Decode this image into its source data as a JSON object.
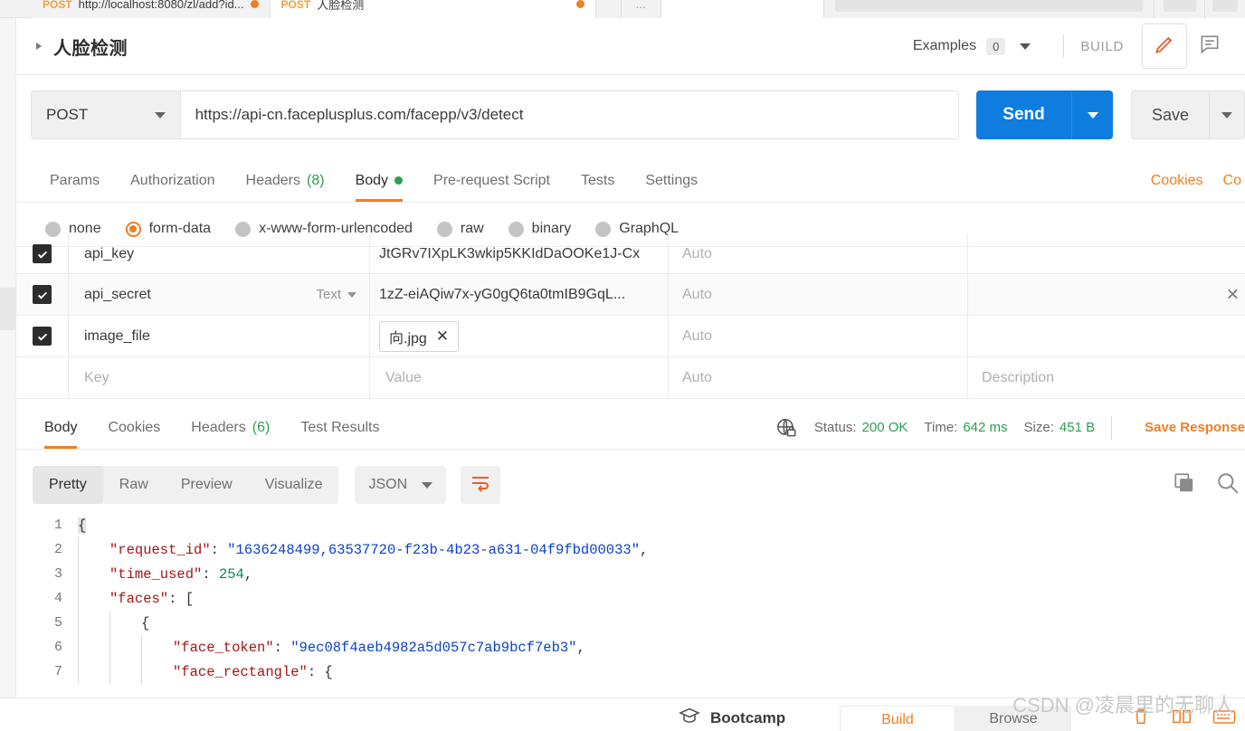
{
  "tabs": {
    "items": [
      {
        "method": "POST",
        "title": "http://localhost:8080/zl/add?id...",
        "unsaved": true,
        "active": false
      },
      {
        "method": "POST",
        "title": "人脸检测",
        "unsaved": true,
        "active": true
      }
    ],
    "more_label": "..."
  },
  "request_header": {
    "title": "人脸检测",
    "examples_label": "Examples",
    "examples_count": "0",
    "build_label": "BUILD",
    "edit_icon": "pencil-icon",
    "comment_icon": "comment-icon"
  },
  "url_bar": {
    "method": "POST",
    "url": "https://api-cn.faceplusplus.com/facepp/v3/detect",
    "send_label": "Send",
    "save_label": "Save"
  },
  "request_tabs": {
    "items": [
      {
        "label": "Params",
        "active": false
      },
      {
        "label": "Authorization",
        "active": false
      },
      {
        "label": "Headers",
        "count": "(8)",
        "active": false
      },
      {
        "label": "Body",
        "active": true,
        "modified": true
      },
      {
        "label": "Pre-request Script",
        "active": false
      },
      {
        "label": "Tests",
        "active": false
      },
      {
        "label": "Settings",
        "active": false
      }
    ],
    "links": [
      {
        "label": "Cookies"
      },
      {
        "label": "Co"
      }
    ]
  },
  "body_types": [
    {
      "label": "none",
      "selected": false
    },
    {
      "label": "form-data",
      "selected": true
    },
    {
      "label": "x-www-form-urlencoded",
      "selected": false
    },
    {
      "label": "raw",
      "selected": false
    },
    {
      "label": "binary",
      "selected": false
    },
    {
      "label": "GraphQL",
      "selected": false
    }
  ],
  "form_data": {
    "columns": {
      "key": "Key",
      "value": "Value",
      "auto": "Auto",
      "description": "Description"
    },
    "rows": [
      {
        "checked": true,
        "key": "api_key",
        "type": "",
        "value": "JtGRv7IXpLK3wkip5KKIdDaOOKe1J-Cx",
        "value_kind": "text",
        "auto": "Auto",
        "description": ""
      },
      {
        "checked": true,
        "key": "api_secret",
        "type": "Text",
        "value": "1zZ-eiAQiw7x-yG0gQ6ta0tmIB9GqL...",
        "value_kind": "text",
        "auto": "Auto",
        "description": "",
        "hovered": true
      },
      {
        "checked": true,
        "key": "image_file",
        "type": "",
        "value": "向.jpg",
        "value_kind": "file",
        "auto": "Auto",
        "description": ""
      },
      {
        "checked": false,
        "key": "Key",
        "type": "",
        "value": "Value",
        "value_kind": "placeholder",
        "auto": "Auto",
        "description": "Description"
      }
    ]
  },
  "response": {
    "tabs": [
      {
        "label": "Body",
        "active": true
      },
      {
        "label": "Cookies",
        "active": false
      },
      {
        "label": "Headers",
        "count": "(6)",
        "active": false
      },
      {
        "label": "Test Results",
        "active": false
      }
    ],
    "status_label": "Status:",
    "status_value": "200 OK",
    "time_label": "Time:",
    "time_value": "642 ms",
    "size_label": "Size:",
    "size_value": "451 B",
    "save_response_label": "Save Response",
    "lock_icon": "globe-lock-icon",
    "copy_icon": "copy-icon",
    "search_icon": "search-icon"
  },
  "viewer": {
    "modes": [
      {
        "label": "Pretty",
        "active": true
      },
      {
        "label": "Raw",
        "active": false
      },
      {
        "label": "Preview",
        "active": false
      },
      {
        "label": "Visualize",
        "active": false
      }
    ],
    "format": "JSON",
    "wrap_icon": "wrap-lines-icon"
  },
  "json_response": {
    "lines": [
      {
        "no": "1",
        "indent": 0,
        "tokens": [
          {
            "t": "{",
            "c": "p brace-hl"
          }
        ]
      },
      {
        "no": "2",
        "indent": 1,
        "tokens": [
          {
            "t": "\"request_id\"",
            "c": "k"
          },
          {
            "t": ": ",
            "c": "p"
          },
          {
            "t": "\"1636248499,63537720-f23b-4b23-a631-04f9fbd00033\"",
            "c": "s"
          },
          {
            "t": ",",
            "c": "p"
          }
        ]
      },
      {
        "no": "3",
        "indent": 1,
        "tokens": [
          {
            "t": "\"time_used\"",
            "c": "k"
          },
          {
            "t": ": ",
            "c": "p"
          },
          {
            "t": "254",
            "c": "n"
          },
          {
            "t": ",",
            "c": "p"
          }
        ]
      },
      {
        "no": "4",
        "indent": 1,
        "tokens": [
          {
            "t": "\"faces\"",
            "c": "k"
          },
          {
            "t": ": [",
            "c": "p"
          }
        ]
      },
      {
        "no": "5",
        "indent": 2,
        "tokens": [
          {
            "t": "{",
            "c": "p"
          }
        ]
      },
      {
        "no": "6",
        "indent": 3,
        "tokens": [
          {
            "t": "\"face_token\"",
            "c": "k"
          },
          {
            "t": ": ",
            "c": "p"
          },
          {
            "t": "\"9ec08f4aeb4982a5d057c7ab9bcf7eb3\"",
            "c": "s"
          },
          {
            "t": ",",
            "c": "p"
          }
        ]
      },
      {
        "no": "7",
        "indent": 3,
        "tokens": [
          {
            "t": "\"face_rectangle\"",
            "c": "k"
          },
          {
            "t": ": {",
            "c": "p"
          }
        ]
      }
    ]
  },
  "bottom_bar": {
    "bootcamp_label": "Bootcamp",
    "bootcamp_icon": "graduation-cap-icon",
    "build_label": "Build",
    "browse_label": "Browse",
    "watermark": "CSDN @凌晨里的无聊人"
  }
}
